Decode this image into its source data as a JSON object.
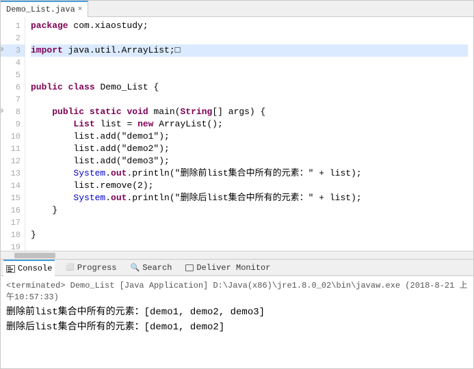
{
  "tab": {
    "filename": "Demo_List.java",
    "close_label": "×"
  },
  "code": {
    "lines": [
      {
        "num": 1,
        "content": "package com.xiaostudy;",
        "highlighted": false,
        "arrow": false
      },
      {
        "num": 2,
        "content": "",
        "highlighted": false,
        "arrow": false
      },
      {
        "num": 3,
        "content": "import java.util.ArrayList;□",
        "highlighted": true,
        "arrow": true
      },
      {
        "num": 4,
        "content": "",
        "highlighted": false,
        "arrow": false
      },
      {
        "num": 5,
        "content": "",
        "highlighted": false,
        "arrow": false
      },
      {
        "num": 6,
        "content": "public class Demo_List {",
        "highlighted": false,
        "arrow": false
      },
      {
        "num": 7,
        "content": "",
        "highlighted": false,
        "arrow": false
      },
      {
        "num": 8,
        "content": "    public static void main(String[] args) {",
        "highlighted": false,
        "arrow": true
      },
      {
        "num": 9,
        "content": "        List list = new ArrayList();",
        "highlighted": false,
        "arrow": false
      },
      {
        "num": 10,
        "content": "        list.add(\"demo1\");",
        "highlighted": false,
        "arrow": false
      },
      {
        "num": 11,
        "content": "        list.add(\"demo2\");",
        "highlighted": false,
        "arrow": false
      },
      {
        "num": 12,
        "content": "        list.add(\"demo3\");",
        "highlighted": false,
        "arrow": false
      },
      {
        "num": 13,
        "content": "        System.out.println(\"删除前list集合中所有的元素：\" + list);",
        "highlighted": false,
        "arrow": false
      },
      {
        "num": 14,
        "content": "        list.remove(2);",
        "highlighted": false,
        "arrow": false
      },
      {
        "num": 15,
        "content": "        System.out.println(\"删除后list集合中所有的元素：\" + list);",
        "highlighted": false,
        "arrow": false
      },
      {
        "num": 16,
        "content": "    }",
        "highlighted": false,
        "arrow": false
      },
      {
        "num": 17,
        "content": "",
        "highlighted": false,
        "arrow": false
      },
      {
        "num": 18,
        "content": "}",
        "highlighted": false,
        "arrow": false
      },
      {
        "num": 19,
        "content": "",
        "highlighted": false,
        "arrow": false
      }
    ]
  },
  "console": {
    "tabs": [
      {
        "id": "console",
        "label": "Console",
        "active": true,
        "icon": "console-icon"
      },
      {
        "id": "progress",
        "label": "Progress",
        "active": false,
        "icon": "progress-icon"
      },
      {
        "id": "search",
        "label": "Search",
        "active": false,
        "icon": "search-icon"
      },
      {
        "id": "deliver",
        "label": "Deliver Monitor",
        "active": false,
        "icon": "deliver-icon"
      }
    ],
    "header": "<terminated> Demo_List [Java Application] D:\\Java(x86)\\jre1.8.0_02\\bin\\javaw.exe (2018-8-21 上午10:57:33)",
    "output": [
      "删除前list集合中所有的元素：[demo1, demo2, demo3]",
      "删除后list集合中所有的元素：[demo1, demo2]"
    ]
  }
}
